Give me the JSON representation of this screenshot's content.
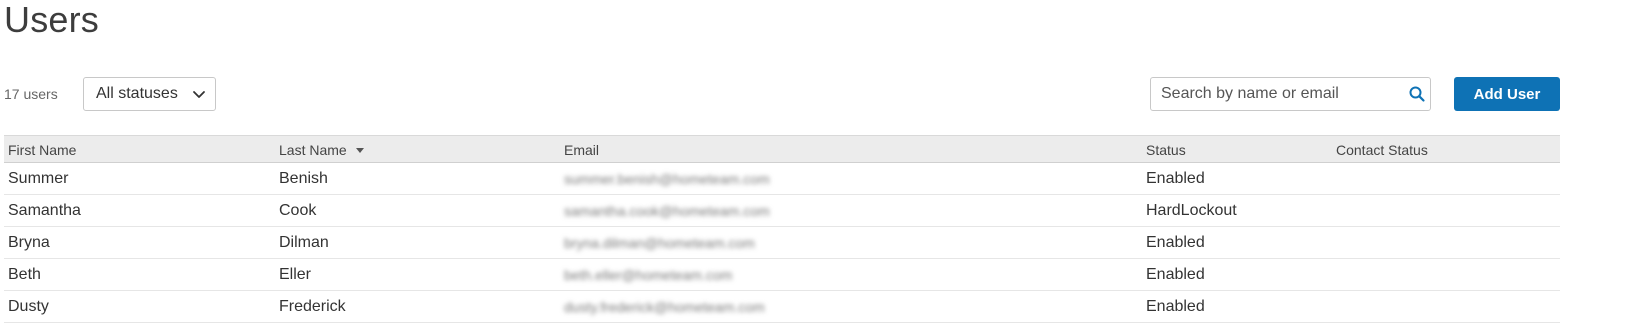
{
  "page": {
    "title": "Users"
  },
  "toolbar": {
    "user_count": "17 users",
    "status_filter": {
      "selected": "All statuses",
      "icon": "chevron-down-icon"
    },
    "search": {
      "placeholder": "Search by name or email",
      "value": "",
      "icon": "search-icon"
    },
    "add_user_label": "Add User"
  },
  "table": {
    "columns": [
      {
        "label": "First Name"
      },
      {
        "label": "Last Name",
        "sorted": "descending"
      },
      {
        "label": "Email"
      },
      {
        "label": "Status"
      },
      {
        "label": "Contact Status"
      }
    ],
    "rows": [
      {
        "first_name": "Summer",
        "last_name": "Benish",
        "email": "summer.benish@hometeam.com",
        "status": "Enabled",
        "contact_status": ""
      },
      {
        "first_name": "Samantha",
        "last_name": "Cook",
        "email": "samantha.cook@hometeam.com",
        "status": "HardLockout",
        "contact_status": ""
      },
      {
        "first_name": "Bryna",
        "last_name": "Dilman",
        "email": "bryna.dilman@hometeam.com",
        "status": "Enabled",
        "contact_status": ""
      },
      {
        "first_name": "Beth",
        "last_name": "Eller",
        "email": "beth.eller@hometeam.com",
        "status": "Enabled",
        "contact_status": ""
      },
      {
        "first_name": "Dusty",
        "last_name": "Frederick",
        "email": "dusty.frederick@hometeam.com",
        "status": "Enabled",
        "contact_status": ""
      }
    ]
  },
  "colors": {
    "accent": "#0e72b5",
    "header_bg": "#ececec",
    "search_icon": "#0e72b5"
  }
}
